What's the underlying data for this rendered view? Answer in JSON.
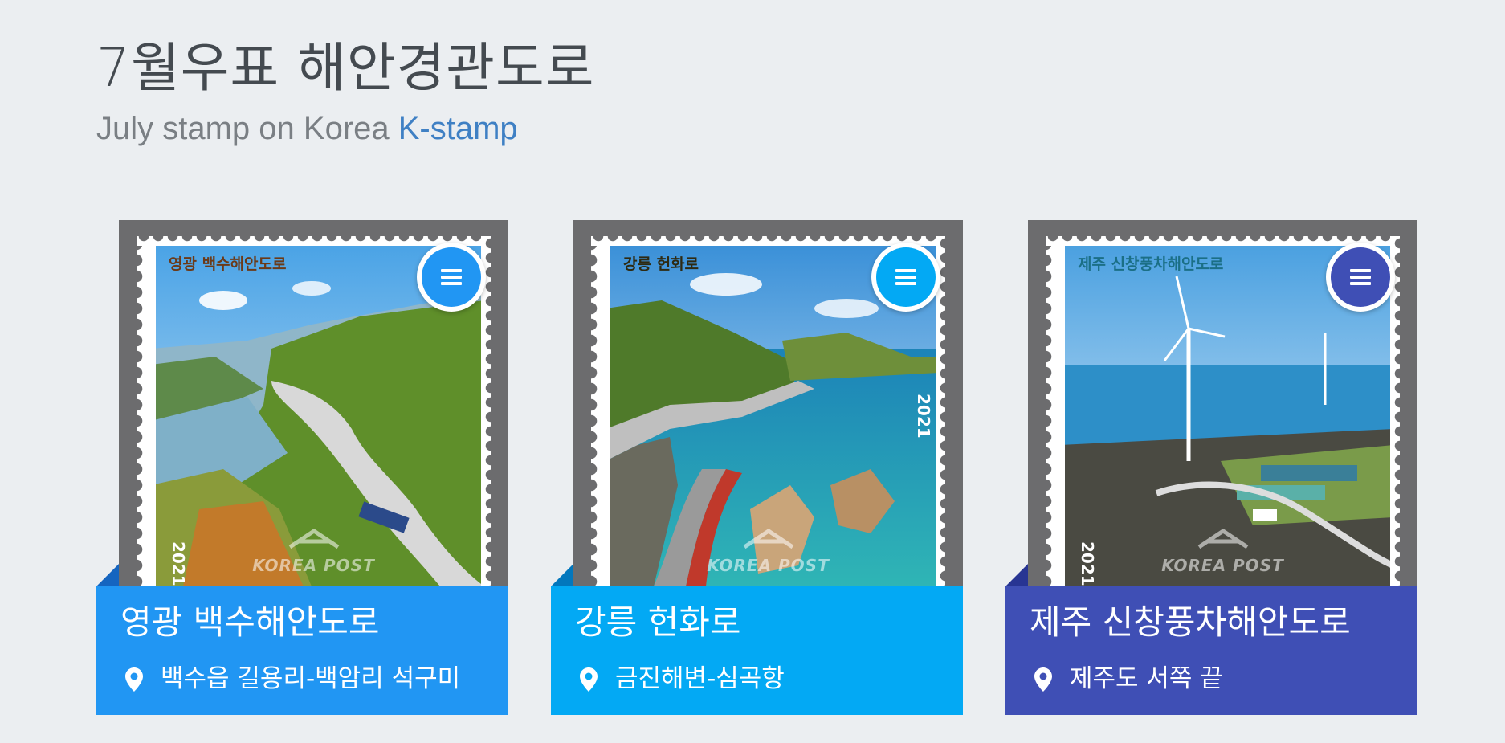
{
  "header": {
    "title": "7월우표 해안경관도로",
    "subtitle_prefix": "July stamp on Korea ",
    "subtitle_accent": "K-stamp"
  },
  "colors": {
    "accent": "#3f80c4",
    "card1": "#2196f3",
    "card2": "#03a9f4",
    "card3": "#3f4fb5"
  },
  "cards": [
    {
      "stamp_label": "영광 백수해안도로",
      "year": "2021",
      "brand": "KOREA POST",
      "name": "영광 백수해안도로",
      "location": "백수읍 길용리-백암리 석구미",
      "menu_icon": "menu-icon",
      "location_icon": "map-pin-icon"
    },
    {
      "stamp_label": "강릉 헌화로",
      "year": "2021",
      "brand": "KOREA POST",
      "name": "강릉 헌화로",
      "location": "금진해변-심곡항",
      "menu_icon": "menu-icon",
      "location_icon": "map-pin-icon"
    },
    {
      "stamp_label": "제주 신창풍차해안도로",
      "year": "2021",
      "brand": "KOREA POST",
      "name": "제주 신창풍차해안도로",
      "location": "제주도 서쪽 끝",
      "menu_icon": "menu-icon",
      "location_icon": "map-pin-icon"
    }
  ]
}
